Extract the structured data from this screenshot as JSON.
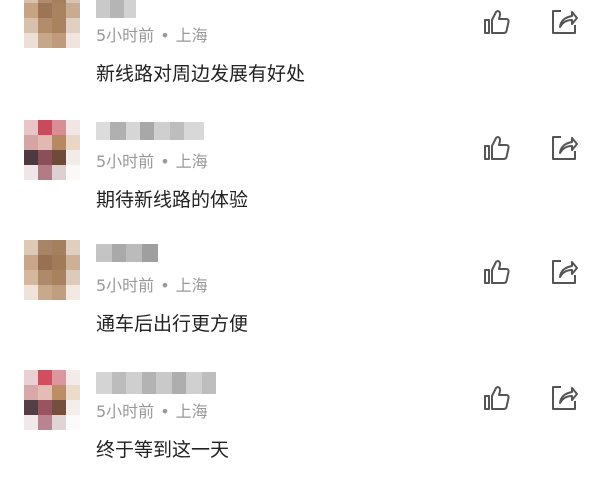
{
  "comments": [
    {
      "time": "5小时前",
      "separator": "•",
      "location": "上海",
      "text": "新线路对周边发展有好处"
    },
    {
      "time": "5小时前",
      "separator": "•",
      "location": "上海",
      "text": "期待新线路的体验"
    },
    {
      "time": "5小时前",
      "separator": "•",
      "location": "上海",
      "text": "通车后出行更方便"
    },
    {
      "time": "5小时前",
      "separator": "•",
      "location": "上海",
      "text": "终于等到这一天"
    }
  ],
  "icons": {
    "like": "thumbs-up-icon",
    "share": "share-icon"
  },
  "colors": {
    "meta_text": "#999999",
    "body_text": "#222222",
    "icon_stroke": "#555555"
  }
}
